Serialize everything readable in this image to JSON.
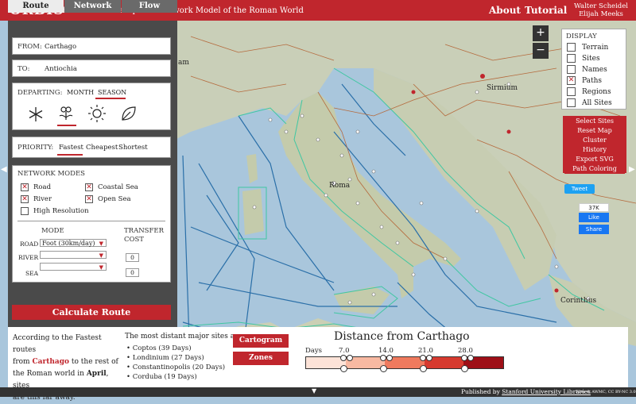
{
  "header": {
    "logo": "ORBIS",
    "subtitle": "The Stanford Geospatial Network Model of the Roman World",
    "nav_about": "About",
    "nav_tutorial": "Tutorial",
    "author1": "Walter Scheidel",
    "author2": "Elijah Meeks"
  },
  "tabs": [
    "Route",
    "Network",
    "Flow"
  ],
  "route": {
    "from_label": "FROM:",
    "from_value": "Carthago",
    "to_label": "TO:",
    "to_value": "Antiochia",
    "departing_label": "DEPARTING:",
    "month_label": "MONTH",
    "season_label": "SEASON",
    "season_icons": [
      "winter-snowflake-icon",
      "spring-flower-icon",
      "summer-sun-icon",
      "autumn-leaf-icon"
    ],
    "priority_label": "PRIORITY:",
    "priority_options": [
      "Fastest",
      "Cheapest",
      "Shortest"
    ],
    "network_modes_label": "NETWORK MODES",
    "modes": {
      "road": "Road",
      "river": "River",
      "high_res": "High Resolution",
      "coastal_sea": "Coastal Sea",
      "open_sea": "Open Sea"
    },
    "mode_header": "MODE",
    "transfer_header_1": "TRANSFER",
    "transfer_header_2": "COST",
    "road_label": "ROAD",
    "road_value": "Foot (30km/day)",
    "river_label": "RIVER",
    "sea_label": "SEA",
    "transfer_values": [
      "0",
      "0"
    ],
    "calculate_label": "Calculate Route"
  },
  "display": {
    "title": "DISPLAY",
    "options": [
      {
        "label": "Terrain",
        "checked": false
      },
      {
        "label": "Sites",
        "checked": false
      },
      {
        "label": "Names",
        "checked": false
      },
      {
        "label": "Paths",
        "checked": true
      },
      {
        "label": "Regions",
        "checked": false
      },
      {
        "label": "All Sites",
        "checked": false
      }
    ]
  },
  "actions": [
    "Select Sites",
    "Reset Map",
    "Cluster",
    "History",
    "Export SVG",
    "Path Coloring"
  ],
  "zoom": {
    "in": "+",
    "out": "−"
  },
  "social": {
    "tweet": "Tweet",
    "like_count": "37K",
    "like": "Like",
    "share": "Share"
  },
  "map_labels": {
    "roma": "Roma",
    "sirmium": "Sirmium",
    "corinthus": "Corinthus",
    "am": "am"
  },
  "summary": {
    "line1": "According to the Fastest routes",
    "line2a": "from ",
    "origin": "Carthago",
    "line2b": " to the rest of",
    "line3": "the Roman world in ",
    "month": "April",
    "line3b": ", sites",
    "line4": "are this far away."
  },
  "distant": {
    "title": "The most distant major sites are:",
    "sites": [
      "Coptos (39 Days)",
      "Londinium (27 Days)",
      "Constantinopolis (20 Days)",
      "Corduba (19 Days)"
    ]
  },
  "buttons": {
    "cartogram": "Cartogram",
    "zones": "Zones"
  },
  "legend": {
    "title": "Distance from Carthago",
    "days_label": "Days",
    "ticks": [
      "7.0",
      "14.0",
      "21.0",
      "28.0"
    ],
    "colors": [
      "#fde3d8",
      "#f8b9a2",
      "#ef7a5e",
      "#d63a2f",
      "#9e0f17"
    ]
  },
  "footer": {
    "published": "Published by ",
    "publisher": "Stanford University Libraries",
    "tiles": "Tiles © AWMC, CC BY-NC 3.0"
  },
  "colors": {
    "brand_red": "#c0262d",
    "panel_dark": "#4a4a4a",
    "sea": "#a9c6dc"
  }
}
